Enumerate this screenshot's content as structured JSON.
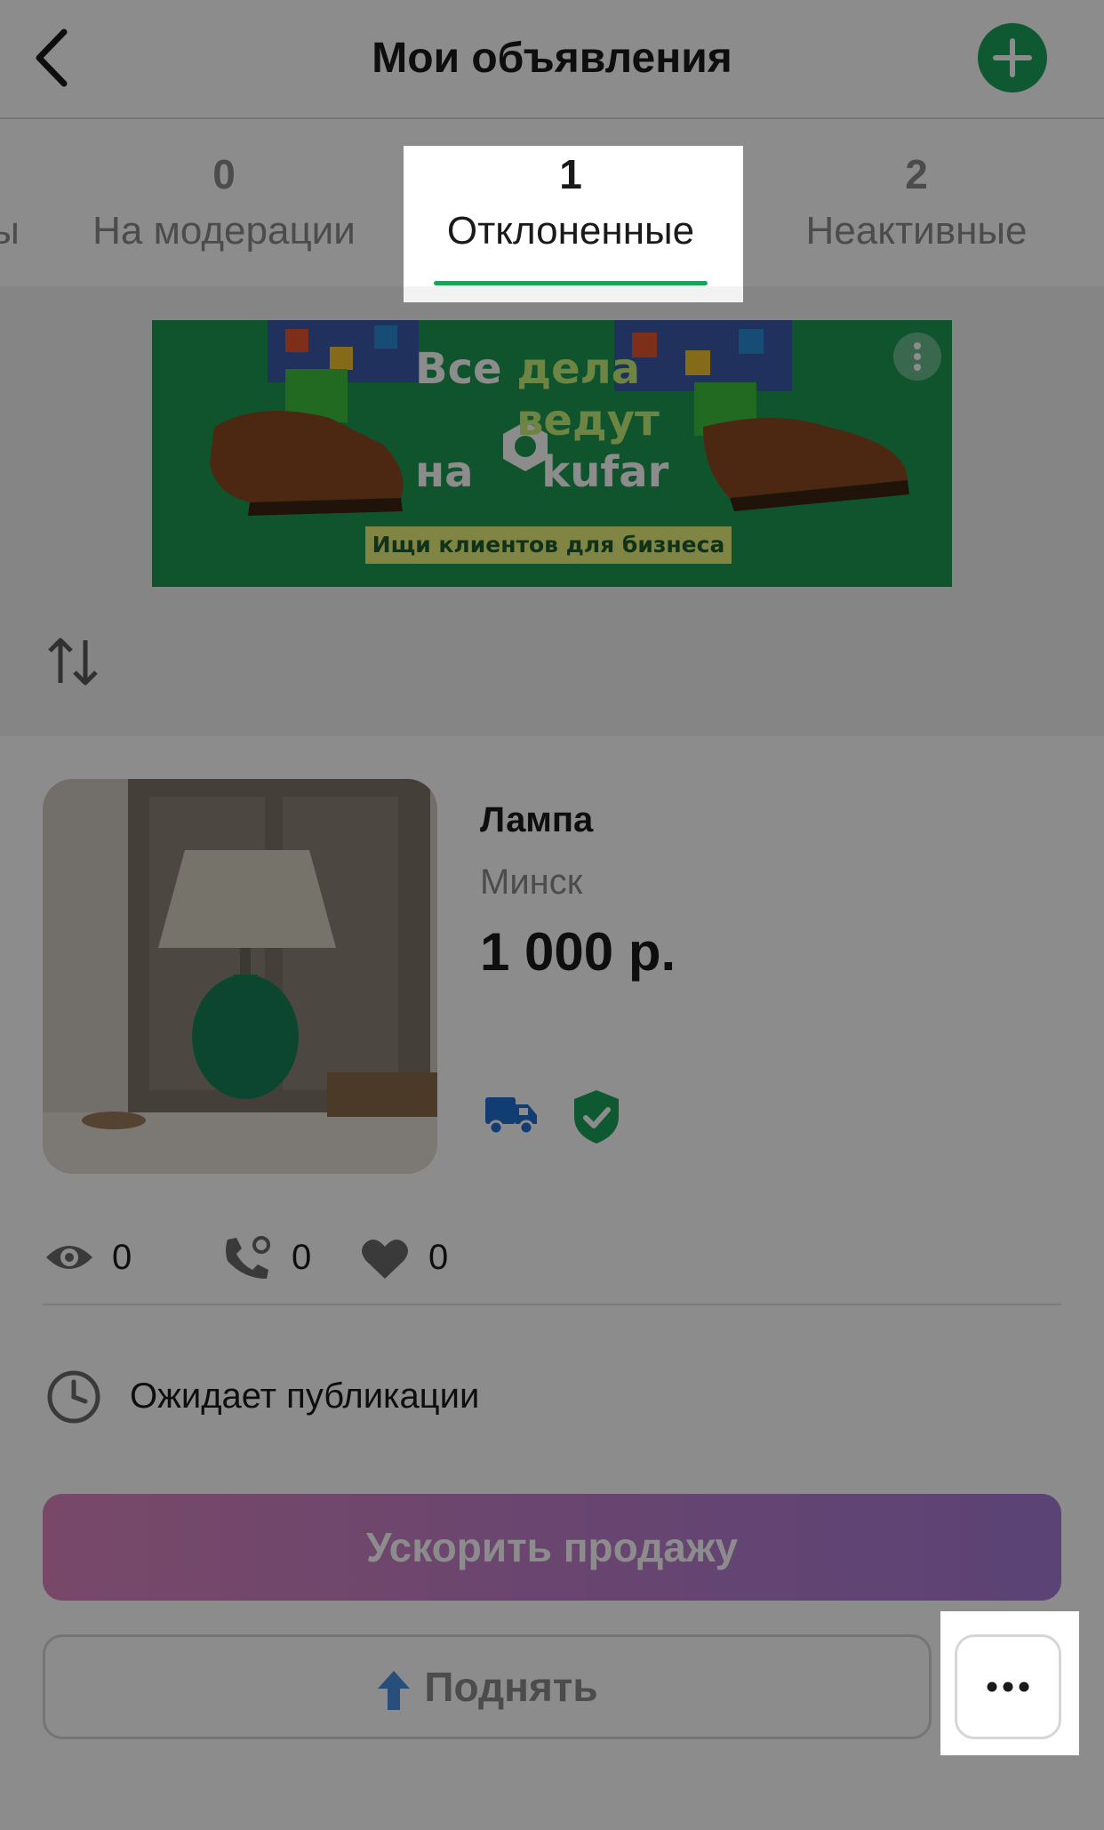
{
  "header": {
    "title": "Мои объявления"
  },
  "tabs": [
    {
      "count": "",
      "label": "ы"
    },
    {
      "count": "0",
      "label": "На модерации"
    },
    {
      "count": "1",
      "label": "Отклоненные",
      "active": true
    },
    {
      "count": "2",
      "label": "Неактивные"
    }
  ],
  "banner": {
    "line1_a": "Все ",
    "line1_b": "дела",
    "line2": "ведут",
    "line3_a": "на ",
    "line3_b": "kufar",
    "cta": "Ищи клиентов для бизнеса"
  },
  "item": {
    "title": "Лампа",
    "city": "Минск",
    "price": "1 000 р.",
    "stats": {
      "views": "0",
      "calls": "0",
      "favorites": "0"
    },
    "status": "Ожидает публикации"
  },
  "actions": {
    "boost": "Ускорить продажу",
    "raise": "Поднять"
  },
  "colors": {
    "accent": "#1aa35a",
    "boost_start": "#dc84c0",
    "boost_end": "#a57ad6",
    "raise_arrow": "#4a90e2",
    "truck": "#1f6fd1"
  }
}
